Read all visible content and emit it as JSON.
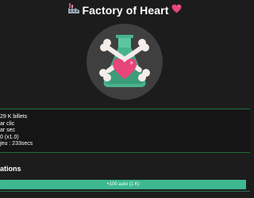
{
  "header": {
    "title": "Factory of Heart",
    "left_icon": "factory-icon",
    "right_icon": "heart-icon",
    "heart_color": "#e8457a"
  },
  "hero": {
    "click_target_icon": "potion-bottle-heart-bones-icon",
    "colors": {
      "circle": "#3f3f3f",
      "bottle": "#49b38d",
      "bone": "#f3ece9",
      "heart": "#e8457a"
    }
  },
  "stats": {
    "tickets": "29 K billets",
    "per_click": "ar clic",
    "per_sec": "ar sec",
    "multiplier": "0 (x1.0)",
    "game_time": "jeu : 233secs"
  },
  "upgrades": {
    "section_title": "ations",
    "buy_button_label": "+100 auto (1 K)"
  },
  "theme": {
    "background": "#1c1c1c",
    "accent": "#3db891",
    "divider": "#1f6d35"
  }
}
